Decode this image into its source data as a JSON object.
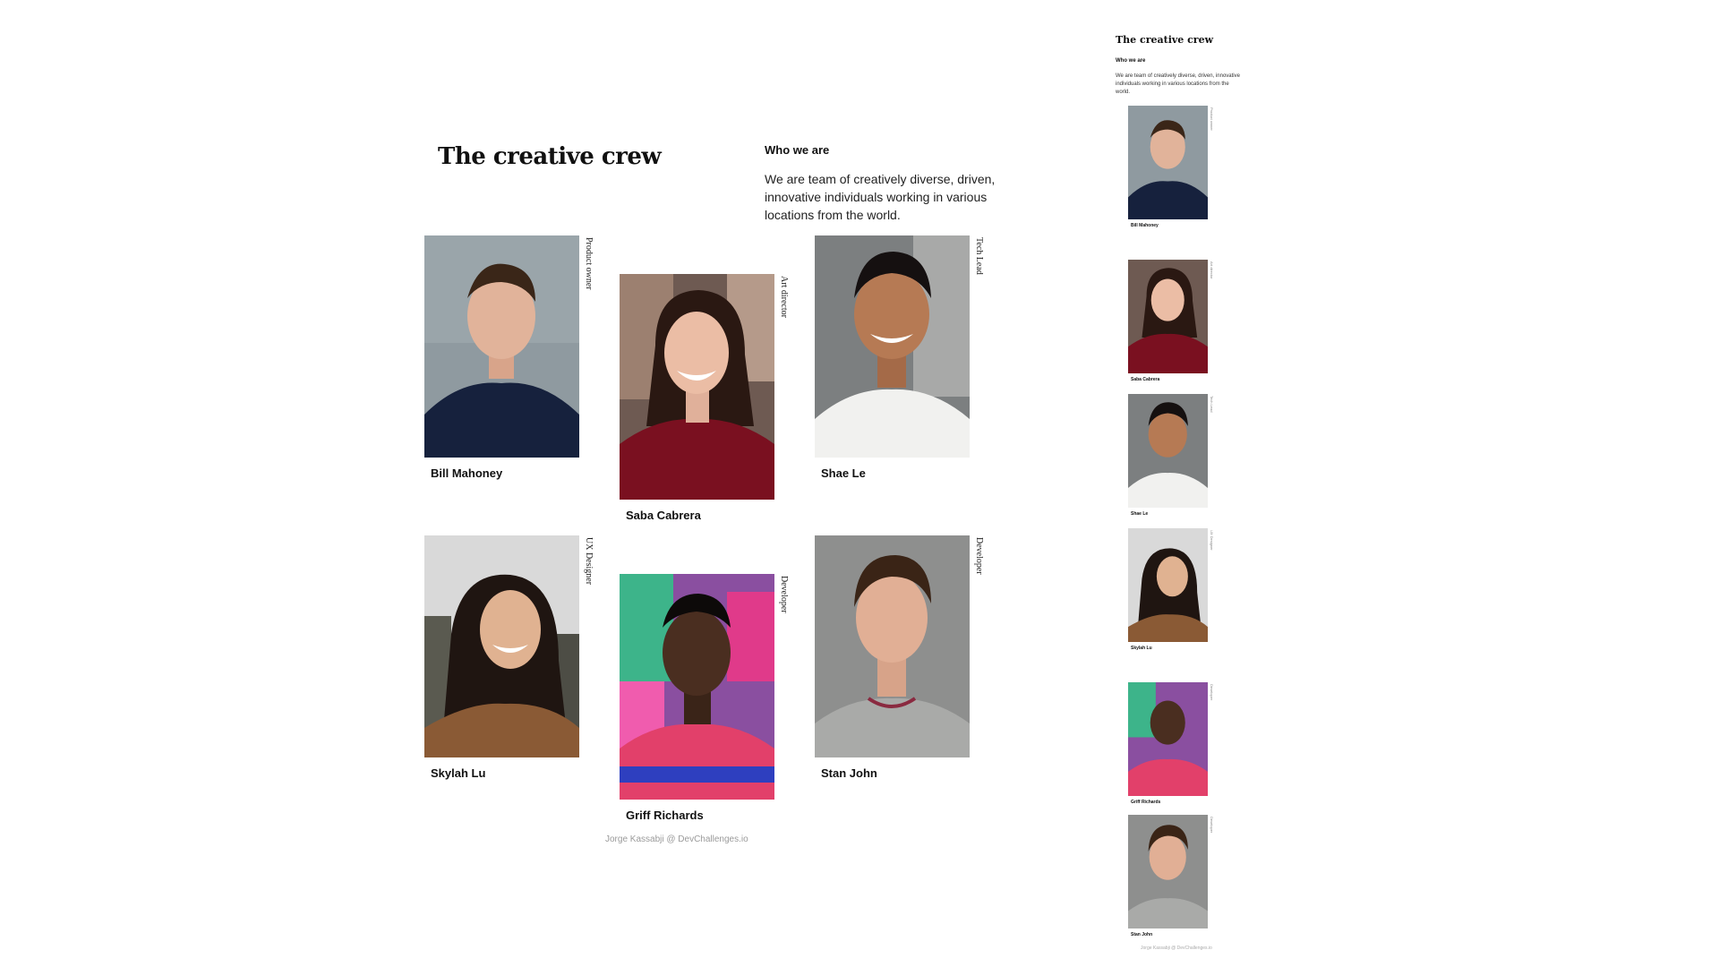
{
  "page": {
    "title": "The creative crew",
    "who_heading": "Who we are",
    "description": "We are team of creatively diverse, driven, innovative individuals working in various locations from the world."
  },
  "members": [
    {
      "name": "Bill Mahoney",
      "role": "Product owner"
    },
    {
      "name": "Saba Cabrera",
      "role": "Art director"
    },
    {
      "name": "Shae Le",
      "role": "Tech Lead"
    },
    {
      "name": "Skylah Lu",
      "role": "UX Designer"
    },
    {
      "name": "Griff Richards",
      "role": "Developer"
    },
    {
      "name": "Stan John",
      "role": "Developer"
    }
  ],
  "footer": "Jorge Kassabji @ DevChallenges.io",
  "colors": {
    "text": "#111111",
    "footer": "#9a9a9a"
  }
}
